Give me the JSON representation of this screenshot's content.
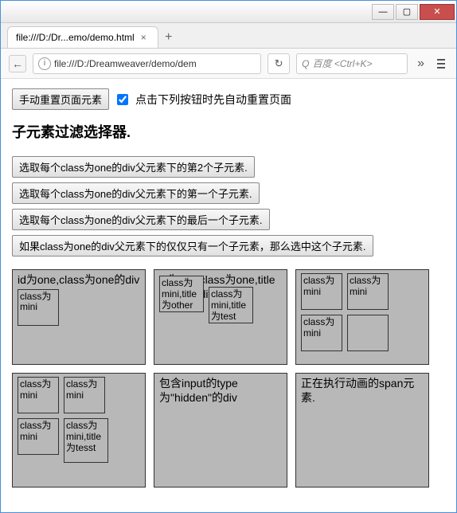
{
  "window": {
    "min": "—",
    "max": "▢",
    "close": "✕"
  },
  "tab": {
    "title": "file:///D:/Dr...emo/demo.html",
    "close": "×",
    "new": "+"
  },
  "urlbar": {
    "back": "←",
    "info": "i",
    "url": "file:///D:/Dreamweaver/demo/dem",
    "reload": "↻",
    "search_icon": "Q",
    "search_placeholder": "百度 <Ctrl+K>",
    "more": "»"
  },
  "toprow": {
    "reset_btn": "手动重置页面元素",
    "auto_label": "点击下列按钮时先自动重置页面"
  },
  "heading": "子元素过滤选择器.",
  "actions": {
    "a1": "选取每个class为one的div父元素下的第2个子元素.",
    "a2": "选取每个class为one的div父元素下的第一个子元素.",
    "a3": "选取每个class为one的div父元素下的最后一个子元素.",
    "a4": "如果class为one的div父元素下的仅仅只有一个子元素，那么选中这个子元素."
  },
  "boxes": {
    "b1": {
      "label": "id为one,class为one的div",
      "m1": "class为mini"
    },
    "b2": {
      "label": "id为two,class为one,title为test的div.",
      "m1": "class为mini,title为other",
      "m2": "class为mini,title为test"
    },
    "b3": {
      "m1": "class为mini",
      "m2": "class为mini",
      "m3": "class为mini",
      "m4": ""
    },
    "b4": {
      "m1": "class为mini",
      "m2": "class为mini",
      "m3": "class为mini",
      "m4": "class为mini,title为tesst"
    },
    "b5": {
      "label": "包含input的type为\"hidden\"的div"
    },
    "b6": {
      "label": "正在执行动画的span元素."
    }
  }
}
